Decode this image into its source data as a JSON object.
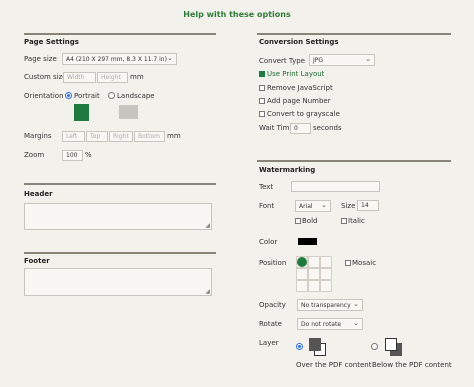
{
  "help_link": "Help with these options",
  "page_settings": {
    "title": "Page Settings",
    "page_size_label": "Page size",
    "page_size_value": "A4 (210 X 297 mm, 8.3 X 11.7 in)",
    "custom_size_label": "Custom size",
    "width_placeholder": "Width",
    "height_placeholder": "Height",
    "unit_mm": "mm",
    "orientation_label": "Orientation",
    "portrait_label": "Portrait",
    "landscape_label": "Landscape",
    "portrait_selected": true,
    "margins_label": "Margins",
    "margin_left": "Left",
    "margin_top": "Top",
    "margin_right": "Right",
    "margin_bottom": "Bottom",
    "margins_unit": "mm",
    "zoom_label": "Zoom",
    "zoom_value": "100",
    "zoom_unit": "%"
  },
  "header": {
    "title": "Header"
  },
  "footer": {
    "title": "Footer"
  },
  "conversion": {
    "title": "Conversion Settings",
    "convert_type_label": "Convert Type",
    "convert_type_value": "JPG",
    "use_print_layout": "Use Print Layout",
    "remove_javascript": "Remove JavaScript",
    "add_page_number": "Add page Number",
    "convert_grayscale": "Convert to grayscale",
    "wait_time_label": "Wait Time",
    "wait_time_value": "0",
    "wait_time_unit": "seconds"
  },
  "watermarking": {
    "title": "Watermarking",
    "text_label": "Text",
    "font_label": "Font",
    "font_value": "Arial",
    "size_label": "Size",
    "size_value": "14",
    "bold_label": "Bold",
    "italic_label": "Italic",
    "color_label": "Color",
    "color_value": "#000000",
    "position_label": "Position",
    "mosaic_label": "Mosaic",
    "opacity_label": "Opacity",
    "opacity_value": "No transparency",
    "rotate_label": "Rotate",
    "rotate_value": "Do not rotate",
    "layer_label": "Layer",
    "over_label": "Over the PDF content",
    "below_label": "Below the PDF content"
  },
  "colors": {
    "accent": "#1f7a3f",
    "link": "#2e7d3a",
    "rule": "#8a8478"
  }
}
